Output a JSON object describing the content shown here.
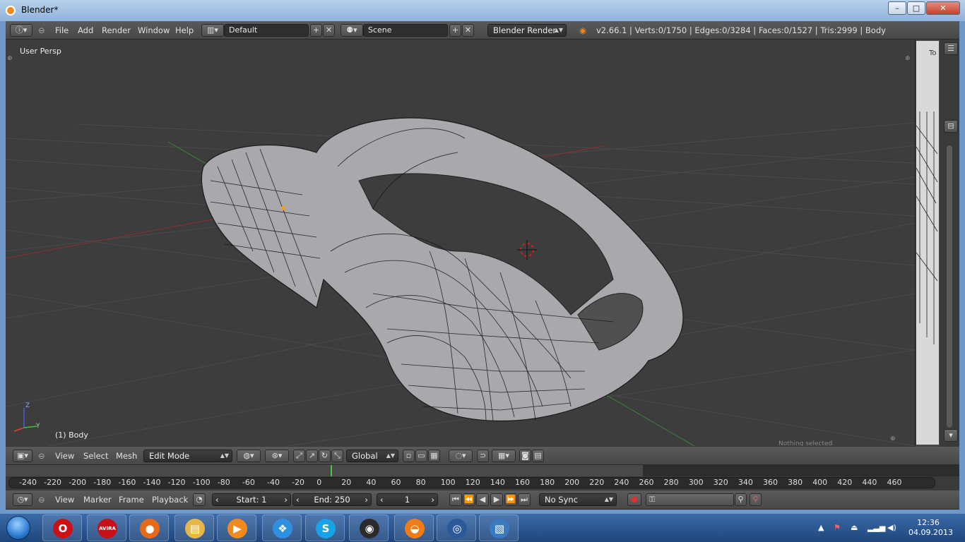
{
  "window": {
    "title": "Blender*",
    "minimize": "–",
    "maximize": "□",
    "close": "✕"
  },
  "info_header": {
    "menus": [
      "File",
      "Add",
      "Render",
      "Window",
      "Help"
    ],
    "screen_layout": "Default",
    "scene": "Scene",
    "render_engine": "Blender Render",
    "stats": "v2.66.1 | Verts:0/1750 | Edges:0/3284 | Faces:0/1527 | Tris:2999 | Body"
  },
  "viewport": {
    "view_label": "User Persp",
    "object_label": "(1) Body",
    "axis_x": "Y",
    "axis_z": "Z",
    "right_panel_hint": "To",
    "panel_note": "Nothing selected"
  },
  "view3d_header": {
    "menus": [
      "View",
      "Select",
      "Mesh"
    ],
    "mode": "Edit Mode",
    "orientation": "Global"
  },
  "timeline": {
    "ticks": [
      "-240",
      "-220",
      "-200",
      "-180",
      "-160",
      "-140",
      "-120",
      "-100",
      "-80",
      "-60",
      "-40",
      "-20",
      "0",
      "20",
      "40",
      "60",
      "80",
      "100",
      "120",
      "140",
      "160",
      "180",
      "200",
      "220",
      "240",
      "260",
      "280",
      "300",
      "320",
      "340",
      "360",
      "380",
      "400",
      "420",
      "440",
      "460"
    ],
    "menus": [
      "View",
      "Marker",
      "Frame",
      "Playback"
    ],
    "start": "Start: 1",
    "end": "End: 250",
    "current_frame": "1",
    "sync": "No Sync"
  },
  "taskbar": {
    "apps": [
      {
        "name": "opera",
        "glyph": "O",
        "color": "#cc1016"
      },
      {
        "name": "avira",
        "glyph": "AVIRA",
        "color": "#c8101a"
      },
      {
        "name": "firefox",
        "glyph": "●",
        "color": "#e66a1a"
      },
      {
        "name": "explorer",
        "glyph": "▤",
        "color": "#e6b84a"
      },
      {
        "name": "media-player",
        "glyph": "▶",
        "color": "#f08a1c"
      },
      {
        "name": "network-app",
        "glyph": "❖",
        "color": "#2f8fe0"
      },
      {
        "name": "skype",
        "glyph": "S",
        "color": "#17a3e6"
      },
      {
        "name": "steam",
        "glyph": "◉",
        "color": "#2b2b2b"
      },
      {
        "name": "blender",
        "glyph": "◒",
        "color": "#f07c16"
      },
      {
        "name": "camera-app",
        "glyph": "◎",
        "color": "#2a5a9a"
      },
      {
        "name": "photo-viewer",
        "glyph": "▧",
        "color": "#3a7ac0"
      }
    ],
    "time": "12:36",
    "date": "04.09.2013"
  }
}
